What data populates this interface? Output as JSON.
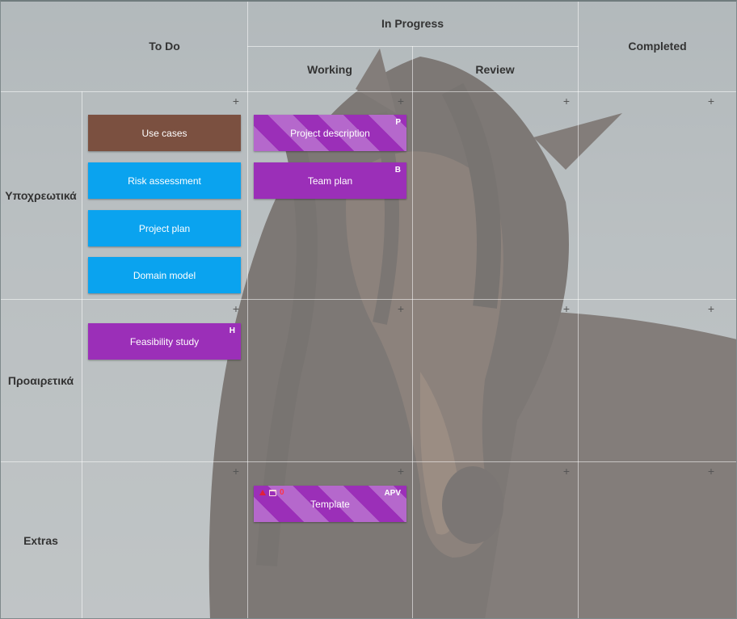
{
  "columns": {
    "todo": "To Do",
    "in_progress": "In Progress",
    "working": "Working",
    "review": "Review",
    "completed": "Completed"
  },
  "rows": {
    "required": "Υποχρεωτικά",
    "optional": "Προαιρετικά",
    "extras": "Extras"
  },
  "add_glyph": "+",
  "cards": {
    "use_cases": {
      "title": "Use cases",
      "color": "#7b5040"
    },
    "risk_assessment": {
      "title": "Risk assessment",
      "color": "#0aa3ef"
    },
    "project_plan": {
      "title": "Project plan",
      "color": "#0aa3ef"
    },
    "domain_model": {
      "title": "Domain model",
      "color": "#0aa3ef"
    },
    "project_description": {
      "title": "Project description",
      "tag": "P",
      "color": "#9b2fb8"
    },
    "team_plan": {
      "title": "Team plan",
      "tag": "B",
      "color": "#9b2fb8"
    },
    "feasibility_study": {
      "title": "Feasibility study",
      "tag": "H",
      "color": "#9b2fb8"
    },
    "template": {
      "title": "Template",
      "tag": "APV",
      "count": "0",
      "color": "#9b2fb8",
      "icons": [
        "arrow-up-icon",
        "calendar-icon"
      ]
    }
  }
}
